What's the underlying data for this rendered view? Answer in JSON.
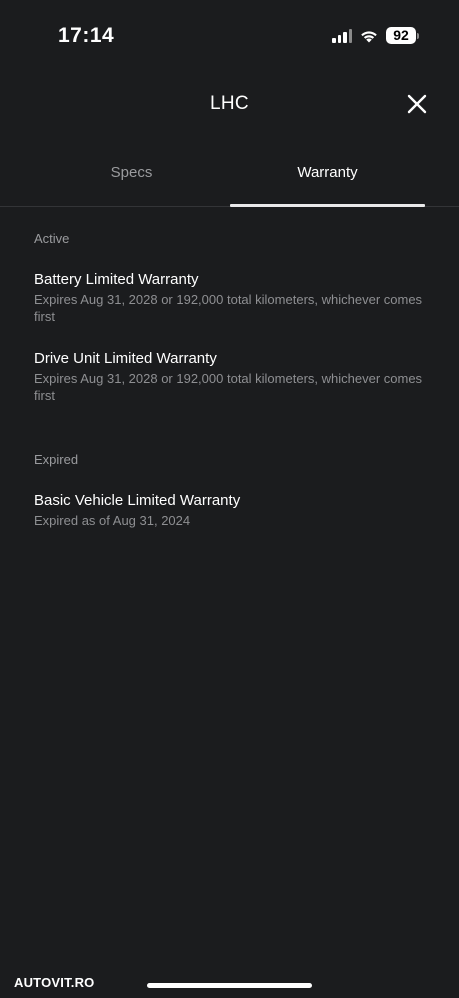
{
  "status_bar": {
    "time": "17:14",
    "battery": "92",
    "icons": [
      "signal-icon",
      "wifi-icon",
      "battery-icon"
    ]
  },
  "header": {
    "title": "LHC",
    "close_icon": "close-icon"
  },
  "tabs": [
    {
      "label": "Specs",
      "active": false
    },
    {
      "label": "Warranty",
      "active": true
    }
  ],
  "sections": {
    "active": {
      "label": "Active",
      "items": [
        {
          "title": "Battery Limited Warranty",
          "description": "Expires Aug 31, 2028 or 192,000 total kilometers, whichever comes first"
        },
        {
          "title": "Drive Unit Limited Warranty",
          "description": "Expires Aug 31, 2028 or 192,000 total kilometers, whichever comes first"
        }
      ]
    },
    "expired": {
      "label": "Expired",
      "items": [
        {
          "title": "Basic Vehicle Limited Warranty",
          "description": "Expired as of Aug 31, 2024"
        }
      ]
    }
  },
  "watermark": "AUTOVIT.RO",
  "colors": {
    "background": "#1b1c1e",
    "text_primary": "#ffffff",
    "text_secondary": "#8e8f92",
    "divider": "#333437"
  }
}
